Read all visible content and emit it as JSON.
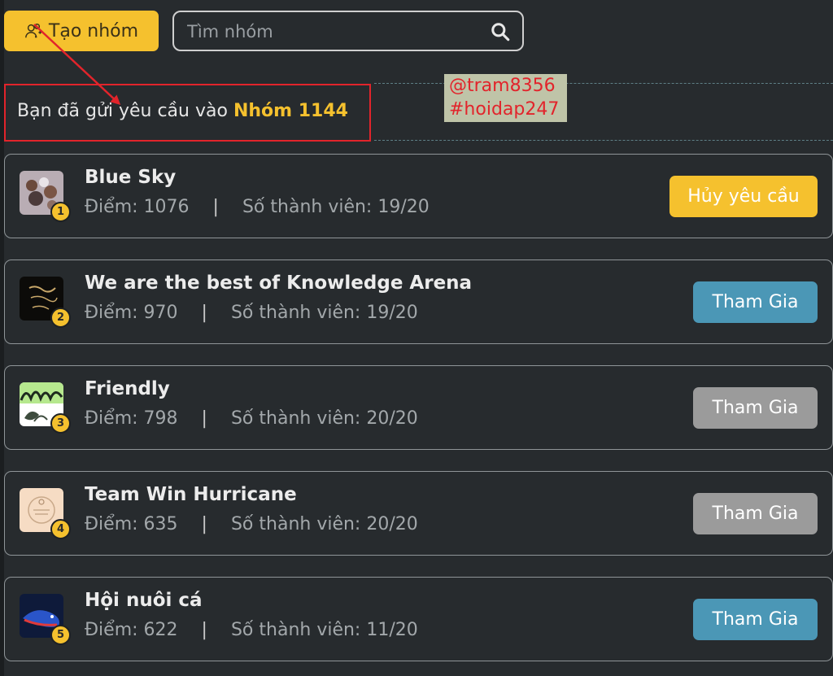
{
  "toolbar": {
    "create_label": "Tạo nhóm",
    "create_icon": "add-user-icon",
    "search_placeholder": "Tìm nhóm",
    "search_value": "",
    "search_icon": "search-icon"
  },
  "notice": {
    "text": "Bạn đã gửi yêu cầu vào",
    "group_name": "Nhóm 1144"
  },
  "watermark": {
    "line1": "@tram8356",
    "line2": "#hoidap247"
  },
  "stats_labels": {
    "points": "Điểm:",
    "members": "Số thành viên:",
    "separator": "|"
  },
  "groups": [
    {
      "rank": "1",
      "name": "Blue Sky",
      "points": "1076",
      "members": "19/20",
      "action": "Hủy yêu cầu",
      "state": "cancel"
    },
    {
      "rank": "2",
      "name": "We are the best of Knowledge Arena",
      "points": "970",
      "members": "19/20",
      "action": "Tham Gia",
      "state": "join"
    },
    {
      "rank": "3",
      "name": "Friendly",
      "points": "798",
      "members": "20/20",
      "action": "Tham Gia",
      "state": "disabled"
    },
    {
      "rank": "4",
      "name": "Team Win Hurricane",
      "points": "635",
      "members": "20/20",
      "action": "Tham Gia",
      "state": "disabled"
    },
    {
      "rank": "5",
      "name": "Hội nuôi cá",
      "points": "622",
      "members": "11/20",
      "action": "Tham Gia",
      "state": "join"
    }
  ],
  "colors": {
    "accent_yellow": "#f5c12e",
    "join_blue": "#4b97b6",
    "disabled_gray": "#9b9b9b",
    "highlight_red": "#e2242b",
    "background": "#272b2e"
  }
}
